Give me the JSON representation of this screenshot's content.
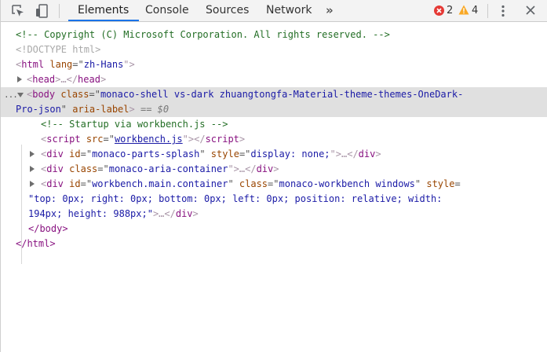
{
  "toolbar": {
    "tabs": [
      "Elements",
      "Console",
      "Sources",
      "Network"
    ],
    "more_tabs": "»",
    "errors": "2",
    "warnings": "4",
    "colors": {
      "active_underline": "#1a73e8",
      "error": "#e53935",
      "warning": "#f9a825"
    },
    "icons": [
      "inspect-icon",
      "device-toolbar-icon",
      "error-icon",
      "warning-icon",
      "more-options-icon",
      "close-icon"
    ]
  },
  "dom": {
    "comment_copyright": "<!-- Copyright (C) Microsoft Corporation. All rights reserved. -->",
    "doctype": "<!DOCTYPE html>",
    "html_open": {
      "lt": "<",
      "tag": "html",
      "attr": " lang",
      "eq": "=\"",
      "val": "zh-Hans",
      "close": "\">"
    },
    "head": {
      "open": "<",
      "tag": "head",
      "mid": ">…</",
      "tag2": "head",
      "end": ">"
    },
    "body_open": {
      "lt": "<",
      "tag": "body",
      "attr1": " class",
      "eq": "=\"",
      "val1_a": "monaco-shell vs-dark zhuangtongfa-Material-theme-themes-OneDark-",
      "val1_b": "Pro-json",
      "q": "\"",
      "attr2": " aria-label",
      "gt": ">",
      "marker": " == $0",
      "dots": "..."
    },
    "comment_startup": "<!-- Startup via workbench.js -->",
    "script": {
      "lt": "<",
      "tag": "script",
      "attr": " src",
      "eq": "=\"",
      "val": "workbench.js",
      "close": "\"></",
      "tag2": "script",
      "gt": ">"
    },
    "div_splash": {
      "lt": "<",
      "tag": "div",
      "attr1": " id",
      "eq": "=\"",
      "val1": "monaco-parts-splash",
      "q": "\"",
      "attr2": " style",
      "val2": "display: none;",
      "end": "\">…</",
      "tag2": "div",
      "gt": ">"
    },
    "div_aria": {
      "lt": "<",
      "tag": "div",
      "attr1": " class",
      "eq": "=\"",
      "val1": "monaco-aria-container",
      "end": "\">…</",
      "tag2": "div",
      "gt": ">"
    },
    "div_workbench": {
      "lt": "<",
      "tag": "div",
      "attr1": " id",
      "eq": "=\"",
      "val1": "workbench.main.container",
      "q": "\"",
      "attr2": " class",
      "val2": "monaco-workbench windows",
      "attr3": " style",
      "eq3": "=",
      "val3_a": "\"top: 0px; right: 0px; bottom: 0px; left: 0px; position: relative; width:",
      "val3_b": "194px; height: 988px;\"",
      "end": ">…</",
      "tag2": "div",
      "gt": ">"
    },
    "body_close": "</body>",
    "html_close": "</html>"
  }
}
